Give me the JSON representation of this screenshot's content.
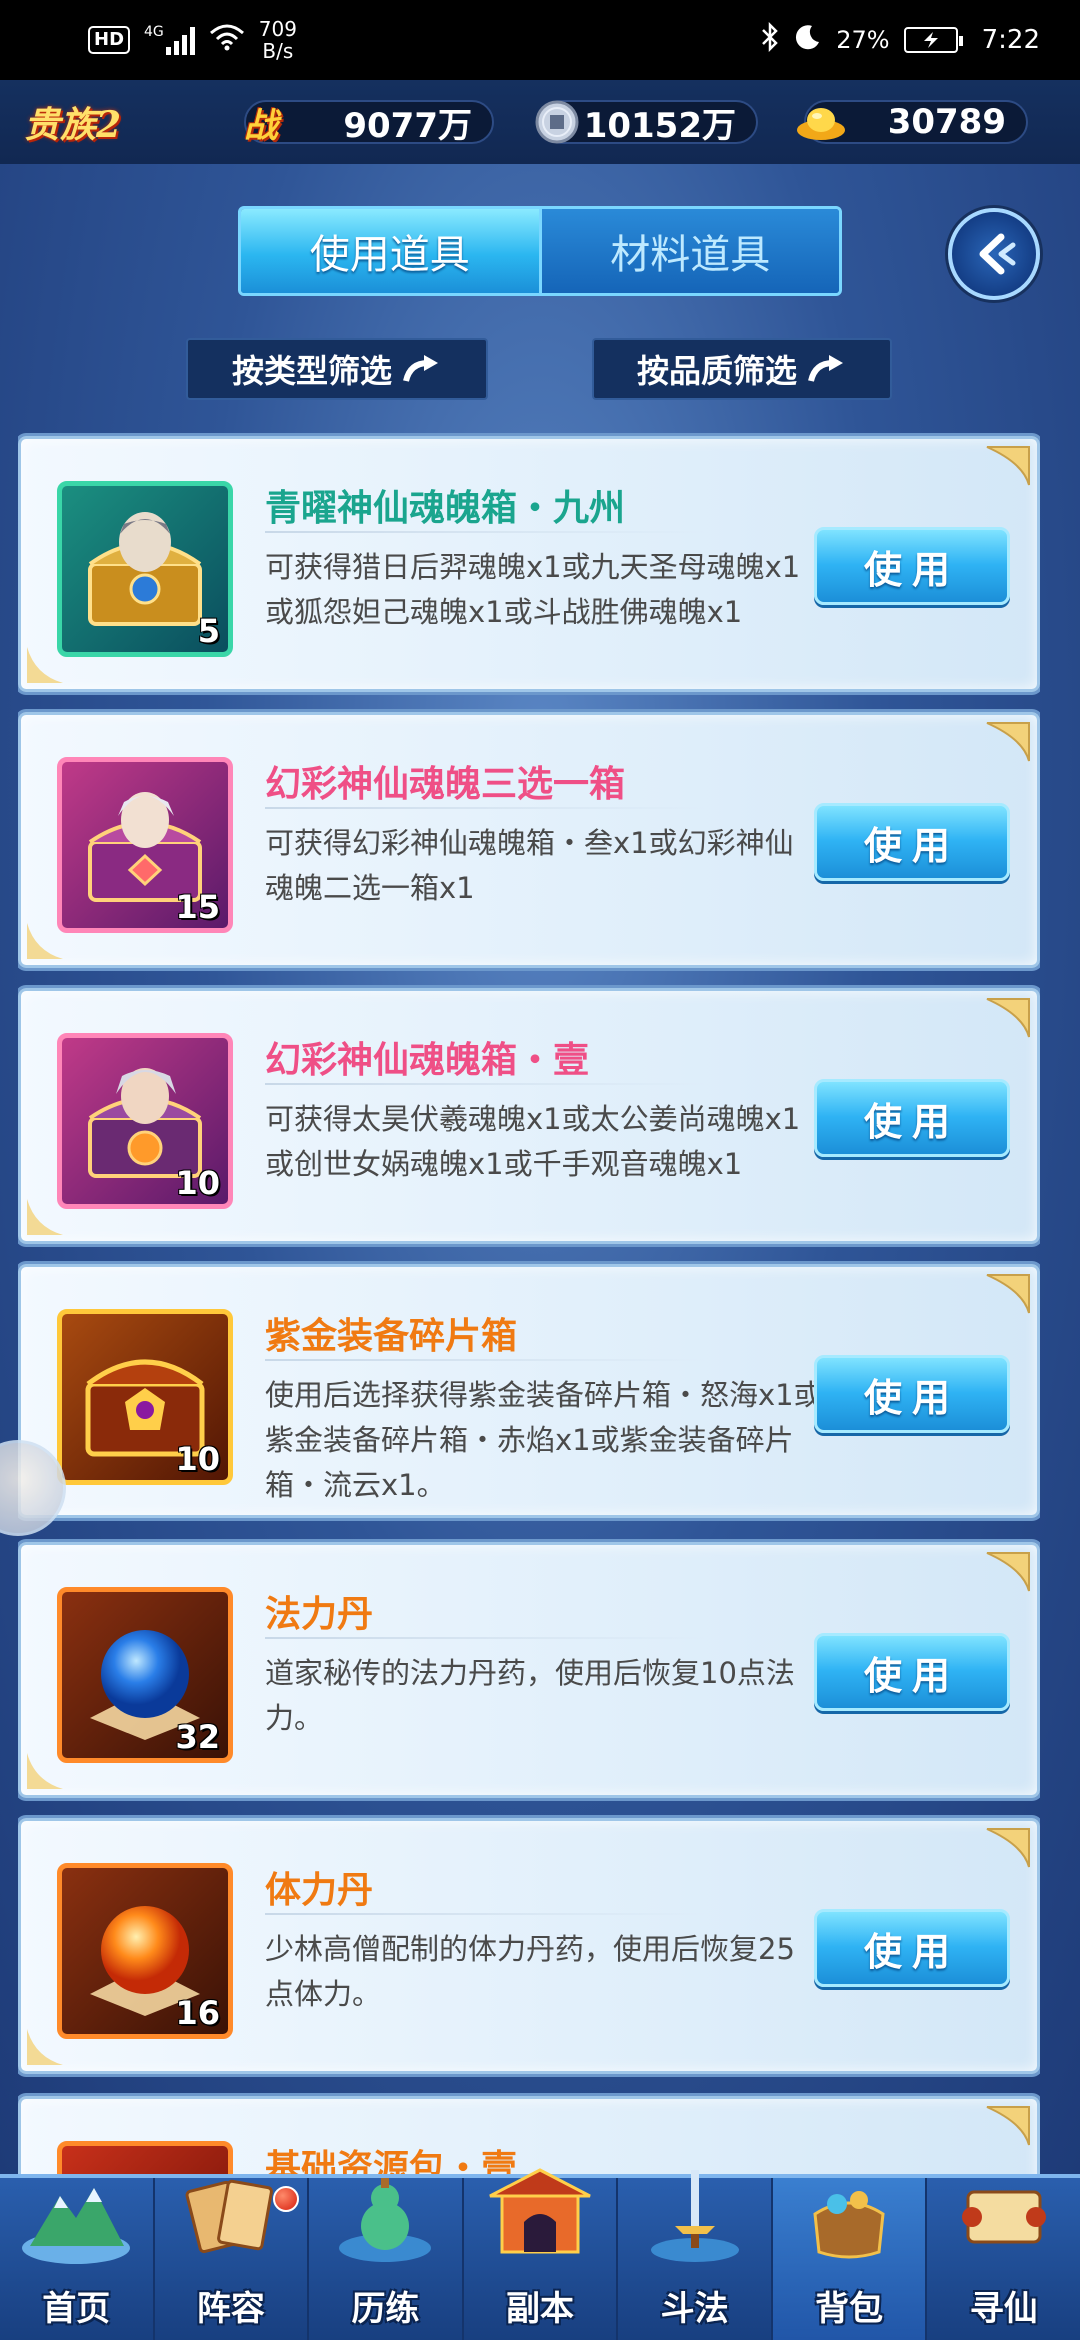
{
  "status_bar": {
    "hd": "HD",
    "network": "4G",
    "speed_value": "709",
    "speed_unit": "B/s",
    "battery": "27",
    "time": "7:22"
  },
  "currency": {
    "noble_level": "贵族2",
    "power_icon_label": "战",
    "power": "9077万",
    "coins": "10152万",
    "gold": "30789"
  },
  "tabs": [
    {
      "label": "使用道具",
      "active": true
    },
    {
      "label": "材料道具",
      "active": false
    }
  ],
  "filters": {
    "by_type": "按类型筛选",
    "by_quality": "按品质筛选"
  },
  "items": [
    {
      "name": "青曜神仙魂魄箱・九州",
      "name_color": "#1aa58e",
      "quality": "teal",
      "count": "5",
      "desc": "可获得猎日后羿魂魄x1或九天圣母魂魄x1或狐怨妲己魂魄x1或斗战胜佛魂魄x1",
      "button": "使用"
    },
    {
      "name": "幻彩神仙魂魄三选一箱",
      "name_color": "#ef4f86",
      "quality": "pink",
      "count": "15",
      "desc": "可获得幻彩神仙魂魄箱・叁x1或幻彩神仙魂魄二选一箱x1",
      "button": "使用"
    },
    {
      "name": "幻彩神仙魂魄箱・壹",
      "name_color": "#ef4f86",
      "quality": "pink",
      "count": "10",
      "desc": "可获得太昊伏羲魂魄x1或太公姜尚魂魄x1或创世女娲魂魄x1或千手观音魂魄x1",
      "button": "使用"
    },
    {
      "name": "紫金装备碎片箱",
      "name_color": "#f07a12",
      "quality": "gold",
      "count": "10",
      "desc": "使用后选择获得紫金装备碎片箱・怒海x1或紫金装备碎片箱・赤焰x1或紫金装备碎片箱・流云x1。",
      "button": "使用"
    },
    {
      "name": "法力丹",
      "name_color": "#f07a12",
      "quality": "orange",
      "count": "32",
      "desc": "道家秘传的法力丹药，使用后恢复10点法力。",
      "button": "使用"
    },
    {
      "name": "体力丹",
      "name_color": "#f07a12",
      "quality": "orange",
      "count": "16",
      "desc": "少林高僧配制的体力丹药，使用后恢复25点体力。",
      "button": "使用"
    },
    {
      "name": "基础资源包・壹",
      "name_color": "#f07a12",
      "quality": "orange",
      "count": "",
      "desc": "",
      "button": ""
    }
  ],
  "nav": [
    {
      "label": "首页",
      "active": false,
      "badge": false
    },
    {
      "label": "阵容",
      "active": false,
      "badge": true
    },
    {
      "label": "历练",
      "active": false,
      "badge": false
    },
    {
      "label": "副本",
      "active": false,
      "badge": false
    },
    {
      "label": "斗法",
      "active": false,
      "badge": false
    },
    {
      "label": "背包",
      "active": true,
      "badge": false
    },
    {
      "label": "寻仙",
      "active": false,
      "badge": false
    }
  ],
  "colors": {
    "accent": "#2fb3f4",
    "noble": "#ffe06a"
  }
}
